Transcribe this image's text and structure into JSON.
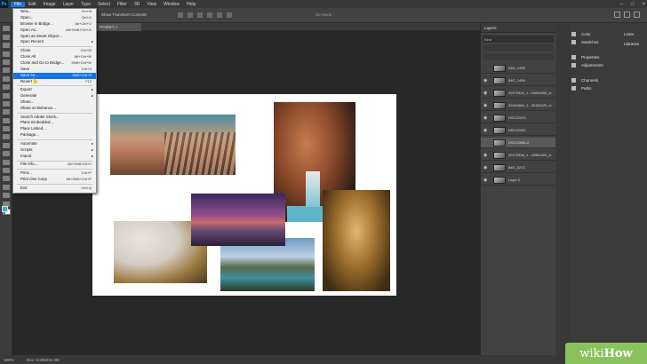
{
  "menubar": {
    "logo": "Ps",
    "items": [
      "File",
      "Edit",
      "Image",
      "Layer",
      "Type",
      "Select",
      "Filter",
      "3D",
      "View",
      "Window",
      "Help"
    ],
    "active_index": 0
  },
  "options_bar": {
    "text": "Show Transform Controls",
    "mode_3d": "3D Mode:"
  },
  "doc_tab": {
    "label": "RGB/8*) ×"
  },
  "file_menu": {
    "items": [
      {
        "label": "New...",
        "shortcut": "Ctrl+N"
      },
      {
        "label": "Open...",
        "shortcut": "Ctrl+O"
      },
      {
        "label": "Browse in Bridge...",
        "shortcut": "Alt+Ctrl+O"
      },
      {
        "label": "Open As...",
        "shortcut": "Alt+Shift+Ctrl+O"
      },
      {
        "label": "Open as Smart Object...",
        "shortcut": ""
      },
      {
        "label": "Open Recent",
        "shortcut": "",
        "submenu": true
      },
      {
        "sep": true
      },
      {
        "label": "Close",
        "shortcut": "Ctrl+W"
      },
      {
        "label": "Close All",
        "shortcut": "Alt+Ctrl+W"
      },
      {
        "label": "Close and Go to Bridge...",
        "shortcut": "Shift+Ctrl+W"
      },
      {
        "label": "Save",
        "shortcut": "Ctrl+S"
      },
      {
        "label": "Save As...",
        "shortcut": "Shift+Ctrl+S",
        "highlight": true
      },
      {
        "label": "Revert",
        "shortcut": "F12"
      },
      {
        "sep": true
      },
      {
        "label": "Export",
        "shortcut": "",
        "submenu": true
      },
      {
        "label": "Generate",
        "shortcut": "",
        "submenu": true
      },
      {
        "label": "Share...",
        "shortcut": ""
      },
      {
        "label": "Share on Behance...",
        "shortcut": ""
      },
      {
        "sep": true
      },
      {
        "label": "Search Adobe Stock...",
        "shortcut": ""
      },
      {
        "label": "Place Embedded...",
        "shortcut": ""
      },
      {
        "label": "Place Linked...",
        "shortcut": ""
      },
      {
        "label": "Package...",
        "shortcut": ""
      },
      {
        "sep": true
      },
      {
        "label": "Automate",
        "shortcut": "",
        "submenu": true
      },
      {
        "label": "Scripts",
        "shortcut": "",
        "submenu": true
      },
      {
        "label": "Import",
        "shortcut": "",
        "submenu": true
      },
      {
        "sep": true
      },
      {
        "label": "File Info...",
        "shortcut": "Alt+Shift+Ctrl+I"
      },
      {
        "sep": true
      },
      {
        "label": "Print...",
        "shortcut": "Ctrl+P"
      },
      {
        "label": "Print One Copy",
        "shortcut": "Alt+Shift+Ctrl+P"
      },
      {
        "sep": true
      },
      {
        "label": "Exit",
        "shortcut": "Ctrl+Q"
      }
    ]
  },
  "layers_panel": {
    "title": "Layers",
    "kind": "Kind",
    "layers": [
      {
        "name": "IMG_1495",
        "visible": false,
        "selected": false
      },
      {
        "name": "IMG_1495",
        "visible": true,
        "selected": false
      },
      {
        "name": "20170910_1...04000400_iv",
        "visible": true,
        "selected": false
      },
      {
        "name": "20151684_1...28150120_iv",
        "visible": true,
        "selected": false
      },
      {
        "name": "DSC02470",
        "visible": true,
        "selected": false
      },
      {
        "name": "DSC02462",
        "visible": true,
        "selected": false
      },
      {
        "name": "DSC02068-2",
        "visible": false,
        "selected": true
      },
      {
        "name": "20170938_1...22561024_iv",
        "visible": true,
        "selected": false
      },
      {
        "name": "IMG_5271",
        "visible": true,
        "selected": false
      },
      {
        "name": "Layer 0",
        "visible": true,
        "selected": false
      }
    ]
  },
  "right_panels": {
    "group1": [
      "Color",
      "Swatches"
    ],
    "group2": [
      "Properties",
      "Adjustments"
    ],
    "group3": [
      "Channels",
      "Paths"
    ],
    "side": [
      "Learn",
      "Libraries"
    ]
  },
  "status_bar": {
    "zoom": "100%",
    "doc": "Doc: 6.59M/44.4M"
  },
  "watermark": {
    "left": "wiki",
    "right": "How"
  }
}
